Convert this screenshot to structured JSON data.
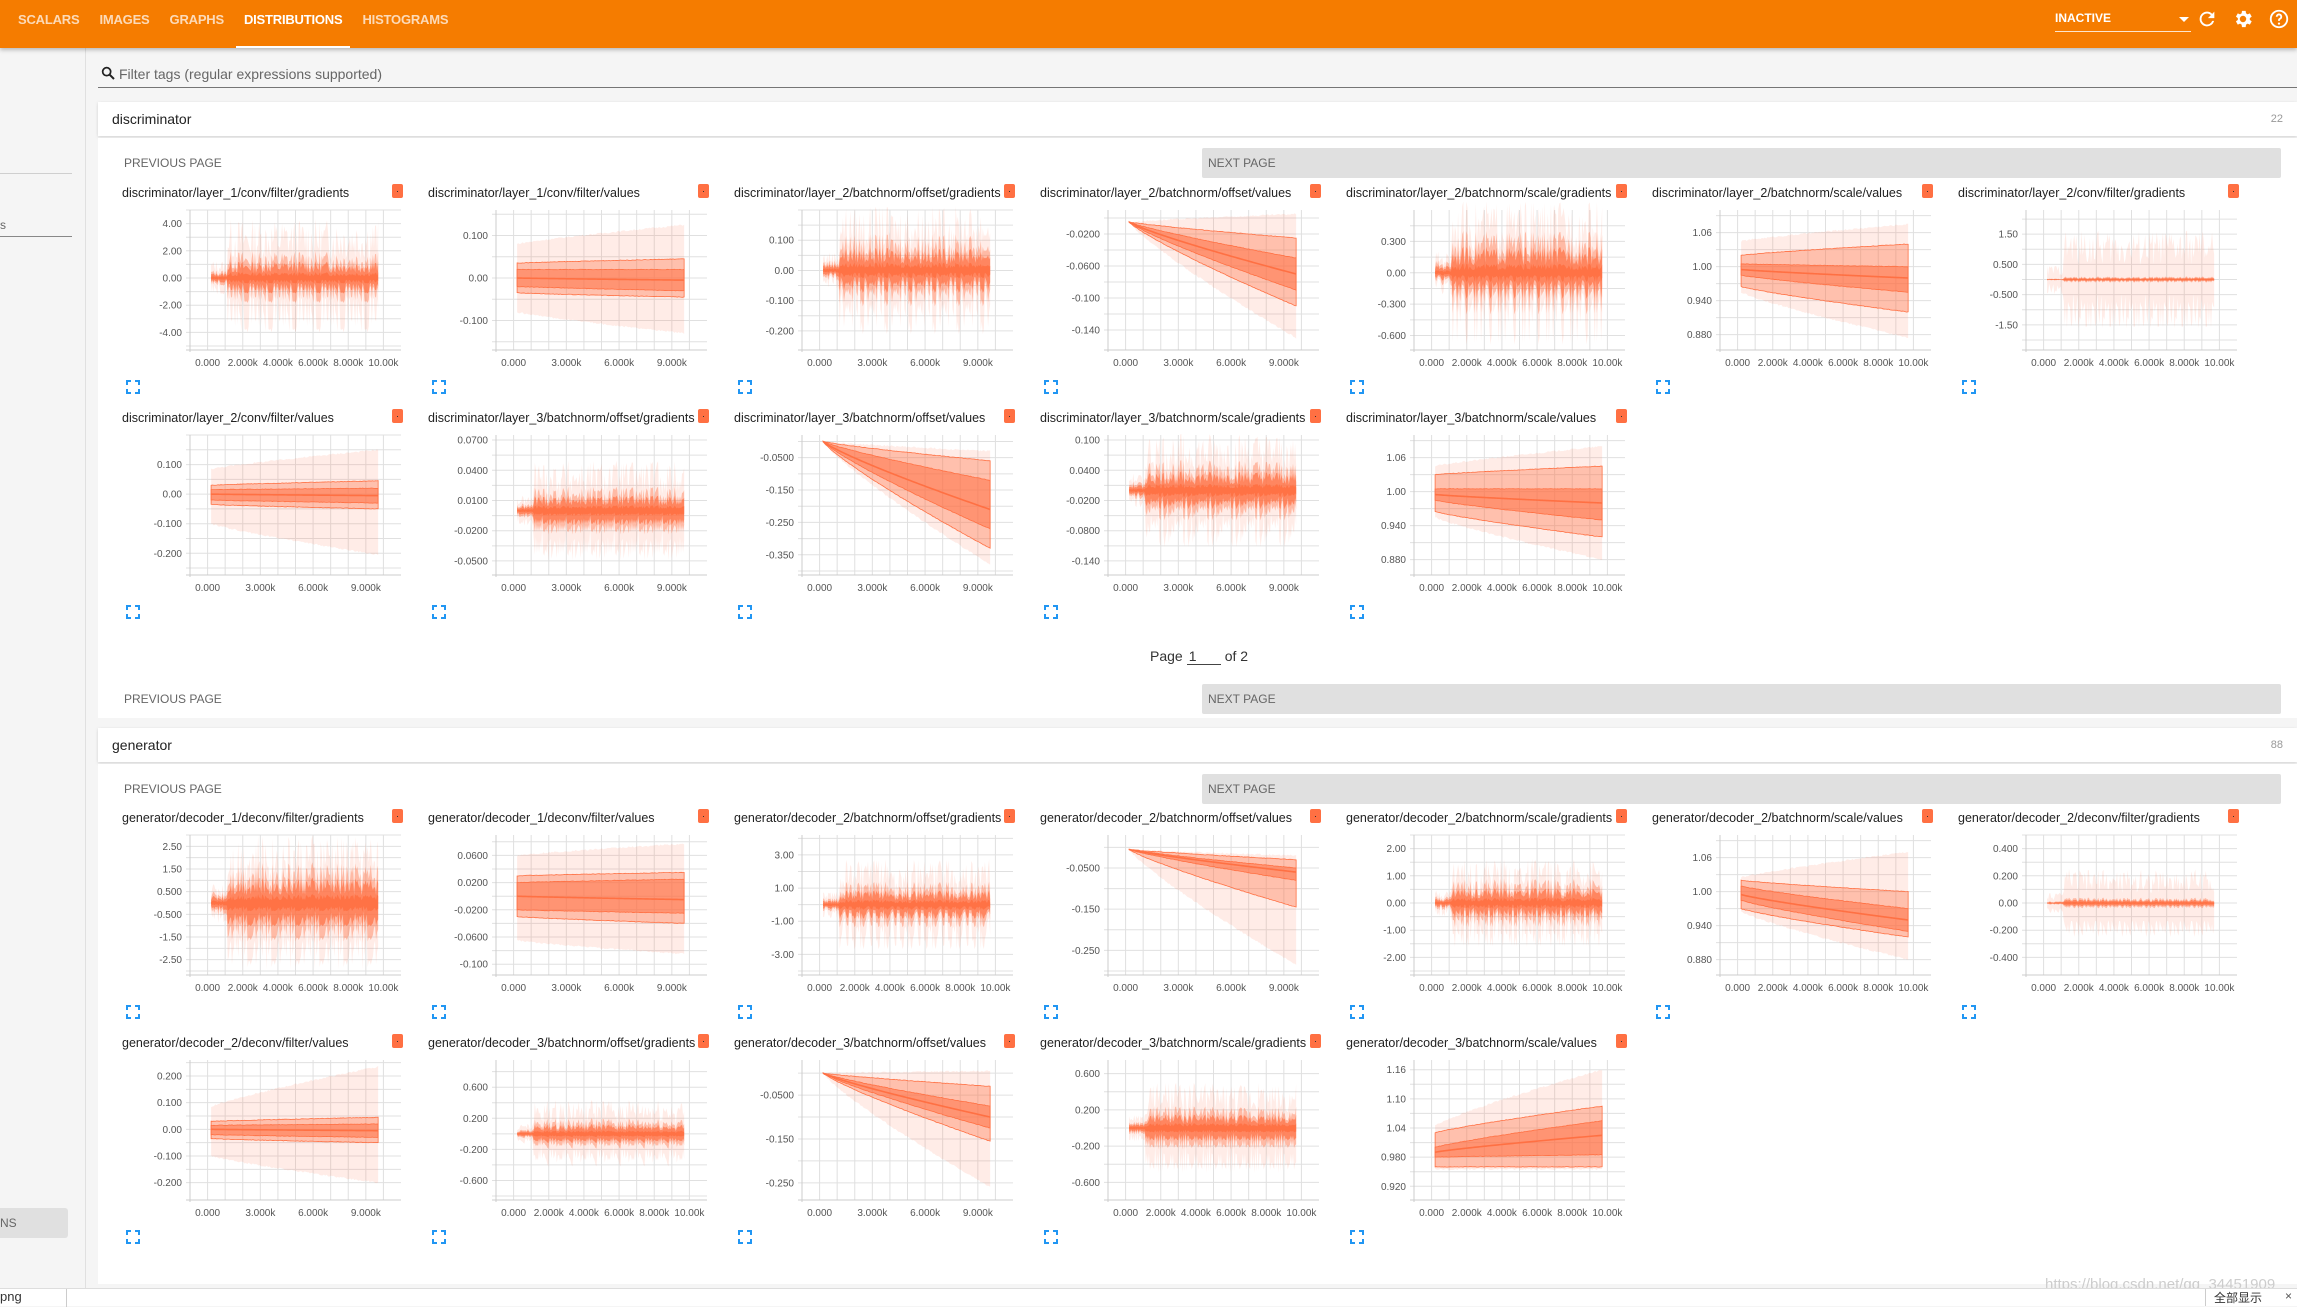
{
  "nav": {
    "tabs": [
      {
        "label": "SCALARS",
        "active": false
      },
      {
        "label": "IMAGES",
        "active": false
      },
      {
        "label": "GRAPHS",
        "active": false
      },
      {
        "label": "DISTRIBUTIONS",
        "active": true
      },
      {
        "label": "HISTOGRAMS",
        "active": false
      }
    ],
    "run_select": "INACTIVE",
    "icons": [
      "refresh-icon",
      "settings-icon",
      "help-icon"
    ]
  },
  "sidebar": {
    "partial_text": "s",
    "partial_button": "NS"
  },
  "filter": {
    "placeholder": "Filter tags (regular expressions supported)",
    "value": ""
  },
  "colors": {
    "accent": "#f57c00",
    "series": "#ff7043"
  },
  "categories": [
    {
      "name": "discriminator",
      "count": "22",
      "prev_label": "PREVIOUS PAGE",
      "next_label": "NEXT PAGE",
      "page_label": "Page",
      "page_current": "1",
      "page_of": "of 2"
    },
    {
      "name": "generator",
      "count": "88",
      "prev_label": "PREVIOUS PAGE",
      "next_label": "NEXT PAGE"
    }
  ],
  "chart_data": [
    {
      "type": "area",
      "title": "discriminator/layer_1/conv/filter/gradients",
      "kind": "noise",
      "center": 0,
      "amp": 1.0,
      "outer": 3.5,
      "ylim": [
        -5,
        5
      ],
      "yticks": [
        "4.00",
        "2.00",
        "0.00",
        "-2.00",
        "-4.00"
      ],
      "ytickvals": [
        4,
        2,
        0,
        -2,
        -4
      ],
      "xticks": [
        "0.000",
        "2.000k",
        "4.000k",
        "6.000k",
        "8.000k",
        "10.00k"
      ],
      "xtickvals": [
        0,
        2000,
        4000,
        6000,
        8000,
        10000
      ],
      "xlim": [
        -1000,
        11000
      ]
    },
    {
      "type": "area",
      "title": "discriminator/layer_1/conv/filter/values",
      "kind": "fan",
      "start": [
        -0.08,
        -0.035,
        -0.02,
        0,
        0.02,
        0.035,
        0.08
      ],
      "end": [
        -0.13,
        -0.045,
        -0.03,
        -0.005,
        0.02,
        0.045,
        0.125
      ],
      "ylim": [
        -0.16,
        0.16
      ],
      "yticks": [
        "0.100",
        "0.00",
        "-0.100"
      ],
      "ytickvals": [
        0.1,
        0,
        -0.1
      ],
      "xticks": [
        "0.000",
        "3.000k",
        "6.000k",
        "9.000k"
      ],
      "xtickvals": [
        0,
        3000,
        6000,
        9000
      ],
      "xlim": [
        -1000,
        11000
      ]
    },
    {
      "type": "area",
      "title": "discriminator/layer_2/batchnorm/offset/gradients",
      "kind": "noise",
      "center": 0,
      "amp": 0.06,
      "outer": 0.17,
      "ylim": [
        -0.25,
        0.2
      ],
      "yticks": [
        "0.100",
        "0.00",
        "-0.100",
        "-0.200"
      ],
      "ytickvals": [
        0.1,
        0,
        -0.1,
        -0.2
      ],
      "xticks": [
        "0.000",
        "3.000k",
        "6.000k",
        "9.000k"
      ],
      "xtickvals": [
        0,
        3000,
        6000,
        9000
      ],
      "xlim": [
        -1000,
        11000
      ]
    },
    {
      "type": "area",
      "title": "discriminator/layer_2/batchnorm/offset/values",
      "kind": "fan",
      "start": [
        -0.005,
        -0.005,
        -0.005,
        -0.005,
        -0.005,
        -0.005,
        -0.005
      ],
      "end": [
        -0.15,
        -0.11,
        -0.09,
        -0.07,
        -0.05,
        -0.025,
        0.005
      ],
      "ylim": [
        -0.16,
        0.01
      ],
      "yticks": [
        "-0.0200",
        "-0.0600",
        "-0.100",
        "-0.140"
      ],
      "ytickvals": [
        -0.02,
        -0.06,
        -0.1,
        -0.14
      ],
      "xticks": [
        "0.000",
        "3.000k",
        "6.000k",
        "9.000k"
      ],
      "xtickvals": [
        0,
        3000,
        6000,
        9000
      ],
      "xlim": [
        -1000,
        11000
      ]
    },
    {
      "type": "area",
      "title": "discriminator/layer_2/batchnorm/scale/gradients",
      "kind": "noise",
      "center": 0,
      "amp": 0.2,
      "outer": 0.55,
      "ylim": [
        -0.7,
        0.6
      ],
      "yticks": [
        "0.300",
        "0.00",
        "-0.300",
        "-0.600"
      ],
      "ytickvals": [
        0.3,
        0,
        -0.3,
        -0.6
      ],
      "xticks": [
        "0.000",
        "2.000k",
        "4.000k",
        "6.000k",
        "8.000k",
        "10.00k"
      ],
      "xtickvals": [
        0,
        2000,
        4000,
        6000,
        8000,
        10000
      ],
      "xlim": [
        -1000,
        11000
      ]
    },
    {
      "type": "area",
      "title": "discriminator/layer_2/batchnorm/scale/values",
      "kind": "fan",
      "start": [
        0.955,
        0.965,
        0.985,
        0.995,
        1.005,
        1.02,
        1.045
      ],
      "end": [
        0.875,
        0.92,
        0.955,
        0.98,
        1.0,
        1.04,
        1.075
      ],
      "ylim": [
        0.86,
        1.1
      ],
      "yticks": [
        "1.06",
        "1.00",
        "0.940",
        "0.880"
      ],
      "ytickvals": [
        1.06,
        1.0,
        0.94,
        0.88
      ],
      "xticks": [
        "0.000",
        "2.000k",
        "4.000k",
        "6.000k",
        "8.000k",
        "10.00k"
      ],
      "xtickvals": [
        0,
        2000,
        4000,
        6000,
        8000,
        10000
      ],
      "xlim": [
        -1000,
        11000
      ]
    },
    {
      "type": "area",
      "title": "discriminator/layer_2/conv/filter/gradients",
      "kind": "noise",
      "center": 0,
      "amp": 0.05,
      "outer": 1.3,
      "ylim": [
        -2.2,
        2.3
      ],
      "yticks": [
        "1.50",
        "0.500",
        "-0.500",
        "-1.50"
      ],
      "ytickvals": [
        1.5,
        0.5,
        -0.5,
        -1.5
      ],
      "xticks": [
        "0.000",
        "2.000k",
        "4.000k",
        "6.000k",
        "8.000k",
        "10.00k"
      ],
      "xtickvals": [
        0,
        2000,
        4000,
        6000,
        8000,
        10000
      ],
      "xlim": [
        -1000,
        11000
      ]
    },
    {
      "type": "area",
      "title": "discriminator/layer_2/conv/filter/values",
      "kind": "fan",
      "start": [
        -0.1,
        -0.035,
        -0.02,
        0,
        0.015,
        0.03,
        0.085
      ],
      "end": [
        -0.205,
        -0.05,
        -0.03,
        -0.005,
        0.02,
        0.045,
        0.15
      ],
      "ylim": [
        -0.26,
        0.2
      ],
      "yticks": [
        "0.100",
        "0.00",
        "-0.100",
        "-0.200"
      ],
      "ytickvals": [
        0.1,
        0,
        -0.1,
        -0.2
      ],
      "xticks": [
        "0.000",
        "3.000k",
        "6.000k",
        "9.000k"
      ],
      "xtickvals": [
        0,
        3000,
        6000,
        9000
      ],
      "xlim": [
        -1000,
        11000
      ]
    },
    {
      "type": "area",
      "title": "discriminator/layer_3/batchnorm/offset/gradients",
      "kind": "noise",
      "center": 0,
      "amp": 0.012,
      "outer": 0.04,
      "ylim": [
        -0.06,
        0.075
      ],
      "yticks": [
        "0.0700",
        "0.0400",
        "0.0100",
        "-0.0200",
        "-0.0500"
      ],
      "ytickvals": [
        0.07,
        0.04,
        0.01,
        -0.02,
        -0.05
      ],
      "xticks": [
        "0.000",
        "3.000k",
        "6.000k",
        "9.000k"
      ],
      "xtickvals": [
        0,
        3000,
        6000,
        9000
      ],
      "xlim": [
        -1000,
        11000
      ]
    },
    {
      "type": "area",
      "title": "discriminator/layer_3/batchnorm/offset/values",
      "kind": "fan",
      "start": [
        0,
        0,
        0,
        0,
        0,
        0,
        0
      ],
      "end": [
        -0.38,
        -0.33,
        -0.27,
        -0.21,
        -0.12,
        -0.06,
        -0.03
      ],
      "ylim": [
        -0.4,
        0.02
      ],
      "yticks": [
        "-0.0500",
        "-0.150",
        "-0.250",
        "-0.350"
      ],
      "ytickvals": [
        -0.05,
        -0.15,
        -0.25,
        -0.35
      ],
      "xticks": [
        "0.000",
        "3.000k",
        "6.000k",
        "9.000k"
      ],
      "xtickvals": [
        0,
        3000,
        6000,
        9000
      ],
      "xlim": [
        -1000,
        11000
      ]
    },
    {
      "type": "area",
      "title": "discriminator/layer_3/batchnorm/scale/gradients",
      "kind": "noise",
      "center": 0,
      "amp": 0.03,
      "outer": 0.09,
      "ylim": [
        -0.16,
        0.11
      ],
      "yticks": [
        "0.100",
        "0.0400",
        "-0.0200",
        "-0.0800",
        "-0.140"
      ],
      "ytickvals": [
        0.1,
        0.04,
        -0.02,
        -0.08,
        -0.14
      ],
      "xticks": [
        "0.000",
        "3.000k",
        "6.000k",
        "9.000k"
      ],
      "xtickvals": [
        0,
        3000,
        6000,
        9000
      ],
      "xlim": [
        -1000,
        11000
      ]
    },
    {
      "type": "area",
      "title": "discriminator/layer_3/batchnorm/scale/values",
      "kind": "fan",
      "start": [
        0.955,
        0.965,
        0.985,
        0.995,
        1.005,
        1.03,
        1.045
      ],
      "end": [
        0.88,
        0.92,
        0.95,
        0.98,
        1.005,
        1.045,
        1.08
      ],
      "ylim": [
        0.86,
        1.1
      ],
      "yticks": [
        "1.06",
        "1.00",
        "0.940",
        "0.880"
      ],
      "ytickvals": [
        1.06,
        1.0,
        0.94,
        0.88
      ],
      "xticks": [
        "0.000",
        "2.000k",
        "4.000k",
        "6.000k",
        "8.000k",
        "10.00k"
      ],
      "xtickvals": [
        0,
        2000,
        4000,
        6000,
        8000,
        10000
      ],
      "xlim": [
        -1000,
        11000
      ]
    },
    {
      "type": "area",
      "title": "generator/decoder_1/deconv/filter/gradients",
      "kind": "noise",
      "center": 0,
      "amp": 0.9,
      "outer": 2.4,
      "ylim": [
        -3,
        3
      ],
      "yticks": [
        "2.50",
        "1.50",
        "0.500",
        "-0.500",
        "-1.50",
        "-2.50"
      ],
      "ytickvals": [
        2.5,
        1.5,
        0.5,
        -0.5,
        -1.5,
        -2.5
      ],
      "xticks": [
        "0.000",
        "2.000k",
        "4.000k",
        "6.000k",
        "8.000k",
        "10.00k"
      ],
      "xtickvals": [
        0,
        2000,
        4000,
        6000,
        8000,
        10000
      ],
      "xlim": [
        -1000,
        11000
      ]
    },
    {
      "type": "area",
      "title": "generator/decoder_1/deconv/filter/values",
      "kind": "fan",
      "start": [
        -0.065,
        -0.03,
        -0.02,
        0,
        0.02,
        0.03,
        0.06
      ],
      "end": [
        -0.085,
        -0.04,
        -0.025,
        -0.005,
        0.025,
        0.035,
        0.077
      ],
      "ylim": [
        -0.11,
        0.09
      ],
      "yticks": [
        "0.0600",
        "0.0200",
        "-0.0200",
        "-0.0600",
        "-0.100"
      ],
      "ytickvals": [
        0.06,
        0.02,
        -0.02,
        -0.06,
        -0.1
      ],
      "xticks": [
        "0.000",
        "3.000k",
        "6.000k",
        "9.000k"
      ],
      "xtickvals": [
        0,
        3000,
        6000,
        9000
      ],
      "xlim": [
        -1000,
        11000
      ]
    },
    {
      "type": "area",
      "title": "generator/decoder_2/batchnorm/offset/gradients",
      "kind": "noise",
      "center": 0,
      "amp": 0.7,
      "outer": 2.2,
      "ylim": [
        -4,
        4.2
      ],
      "yticks": [
        "3.00",
        "1.00",
        "-1.00",
        "-3.00"
      ],
      "ytickvals": [
        3,
        1,
        -1,
        -3
      ],
      "xticks": [
        "0.000",
        "2.000k",
        "4.000k",
        "6.000k",
        "8.000k",
        "10.00k"
      ],
      "xtickvals": [
        0,
        2000,
        4000,
        6000,
        8000,
        10000
      ],
      "xlim": [
        -1000,
        11000
      ]
    },
    {
      "type": "area",
      "title": "generator/decoder_2/batchnorm/offset/values",
      "kind": "fan",
      "start": [
        -0.005,
        -0.005,
        -0.005,
        -0.005,
        -0.005,
        -0.005,
        -0.005
      ],
      "end": [
        -0.285,
        -0.145,
        -0.08,
        -0.06,
        -0.05,
        -0.03,
        -0.02
      ],
      "ylim": [
        -0.3,
        0.03
      ],
      "yticks": [
        "-0.0500",
        "-0.150",
        "-0.250"
      ],
      "ytickvals": [
        -0.05,
        -0.15,
        -0.25
      ],
      "xticks": [
        "0.000",
        "3.000k",
        "6.000k",
        "9.000k"
      ],
      "xtickvals": [
        0,
        3000,
        6000,
        9000
      ],
      "xlim": [
        -1000,
        11000
      ]
    },
    {
      "type": "area",
      "title": "generator/decoder_2/batchnorm/scale/gradients",
      "kind": "noise",
      "center": 0,
      "amp": 0.45,
      "outer": 1.3,
      "ylim": [
        -2.5,
        2.5
      ],
      "yticks": [
        "2.00",
        "1.00",
        "0.00",
        "-1.00",
        "-2.00"
      ],
      "ytickvals": [
        2,
        1,
        0,
        -1,
        -2
      ],
      "xticks": [
        "0.000",
        "2.000k",
        "4.000k",
        "6.000k",
        "8.000k",
        "10.00k"
      ],
      "xtickvals": [
        0,
        2000,
        4000,
        6000,
        8000,
        10000
      ],
      "xlim": [
        -1000,
        11000
      ]
    },
    {
      "type": "area",
      "title": "generator/decoder_2/batchnorm/scale/values",
      "kind": "fan",
      "start": [
        0.965,
        0.97,
        0.985,
        0.995,
        1.01,
        1.02,
        1.025
      ],
      "end": [
        0.88,
        0.92,
        0.93,
        0.95,
        0.97,
        1.0,
        1.07
      ],
      "ylim": [
        0.86,
        1.1
      ],
      "yticks": [
        "1.06",
        "1.00",
        "0.940",
        "0.880"
      ],
      "ytickvals": [
        1.06,
        1.0,
        0.94,
        0.88
      ],
      "xticks": [
        "0.000",
        "2.000k",
        "4.000k",
        "6.000k",
        "8.000k",
        "10.00k"
      ],
      "xtickvals": [
        0,
        2000,
        4000,
        6000,
        8000,
        10000
      ],
      "xlim": [
        -1000,
        11000
      ]
    },
    {
      "type": "area",
      "title": "generator/decoder_2/deconv/filter/gradients",
      "kind": "noise",
      "center": 0,
      "amp": 0.02,
      "outer": 0.2,
      "ylim": [
        -0.5,
        0.5
      ],
      "yticks": [
        "0.400",
        "0.200",
        "0.00",
        "-0.200",
        "-0.400"
      ],
      "ytickvals": [
        0.4,
        0.2,
        0,
        -0.2,
        -0.4
      ],
      "xticks": [
        "0.000",
        "2.000k",
        "4.000k",
        "6.000k",
        "8.000k",
        "10.00k"
      ],
      "xtickvals": [
        0,
        2000,
        4000,
        6000,
        8000,
        10000
      ],
      "xlim": [
        -1000,
        11000
      ]
    },
    {
      "type": "area",
      "title": "generator/decoder_2/deconv/filter/values",
      "kind": "fan",
      "start": [
        -0.1,
        -0.035,
        -0.02,
        0,
        0.015,
        0.03,
        0.085
      ],
      "end": [
        -0.2,
        -0.05,
        -0.03,
        -0.005,
        0.02,
        0.045,
        0.235
      ],
      "ylim": [
        -0.25,
        0.26
      ],
      "yticks": [
        "0.200",
        "0.100",
        "0.00",
        "-0.100",
        "-0.200"
      ],
      "ytickvals": [
        0.2,
        0.1,
        0,
        -0.1,
        -0.2
      ],
      "xticks": [
        "0.000",
        "3.000k",
        "6.000k",
        "9.000k"
      ],
      "xtickvals": [
        0,
        3000,
        6000,
        9000
      ],
      "xlim": [
        -1000,
        11000
      ]
    },
    {
      "type": "area",
      "title": "generator/decoder_3/batchnorm/offset/gradients",
      "kind": "noise",
      "center": 0,
      "amp": 0.1,
      "outer": 0.35,
      "ylim": [
        -0.8,
        0.95
      ],
      "yticks": [
        "0.600",
        "0.200",
        "-0.200",
        "-0.600"
      ],
      "ytickvals": [
        0.6,
        0.2,
        -0.2,
        -0.6
      ],
      "xticks": [
        "0.000",
        "2.000k",
        "4.000k",
        "6.000k",
        "8.000k",
        "10.00k"
      ],
      "xtickvals": [
        0,
        2000,
        4000,
        6000,
        8000,
        10000
      ],
      "xlim": [
        -1000,
        11000
      ]
    },
    {
      "type": "area",
      "title": "generator/decoder_3/batchnorm/offset/values",
      "kind": "fan",
      "start": [
        0,
        0,
        0,
        0,
        0,
        0,
        0
      ],
      "end": [
        -0.26,
        -0.155,
        -0.125,
        -0.1,
        -0.075,
        -0.03,
        0.005
      ],
      "ylim": [
        -0.28,
        0.03
      ],
      "yticks": [
        "-0.0500",
        "-0.150",
        "-0.250"
      ],
      "ytickvals": [
        -0.05,
        -0.15,
        -0.25
      ],
      "xticks": [
        "0.000",
        "3.000k",
        "6.000k",
        "9.000k"
      ],
      "xtickvals": [
        0,
        3000,
        6000,
        9000
      ],
      "xlim": [
        -1000,
        11000
      ]
    },
    {
      "type": "area",
      "title": "generator/decoder_3/batchnorm/scale/gradients",
      "kind": "noise",
      "center": 0,
      "amp": 0.12,
      "outer": 0.4,
      "ylim": [
        -0.75,
        0.75
      ],
      "yticks": [
        "0.600",
        "0.200",
        "-0.200",
        "-0.600"
      ],
      "ytickvals": [
        0.6,
        0.2,
        -0.2,
        -0.6
      ],
      "xticks": [
        "0.000",
        "2.000k",
        "4.000k",
        "6.000k",
        "8.000k",
        "10.00k"
      ],
      "xtickvals": [
        0,
        2000,
        4000,
        6000,
        8000,
        10000
      ],
      "xlim": [
        -1000,
        11000
      ]
    },
    {
      "type": "area",
      "title": "generator/decoder_3/batchnorm/scale/values",
      "kind": "fan",
      "start": [
        0.955,
        0.96,
        0.98,
        0.99,
        1.0,
        1.03,
        1.045
      ],
      "end": [
        0.955,
        0.96,
        0.985,
        1.025,
        1.055,
        1.085,
        1.16
      ],
      "ylim": [
        0.9,
        1.18
      ],
      "yticks": [
        "1.16",
        "1.10",
        "1.04",
        "0.980",
        "0.920"
      ],
      "ytickvals": [
        1.16,
        1.1,
        1.04,
        0.98,
        0.92
      ],
      "xticks": [
        "0.000",
        "2.000k",
        "4.000k",
        "6.000k",
        "8.000k",
        "10.00k"
      ],
      "xtickvals": [
        0,
        2000,
        4000,
        6000,
        8000,
        10000
      ],
      "xlim": [
        -1000,
        11000
      ]
    }
  ],
  "footer": {
    "left_text": "png",
    "watermark": "https://blog.csdn.net/qq_34451909",
    "right_button": "全部显示",
    "close": "×"
  }
}
